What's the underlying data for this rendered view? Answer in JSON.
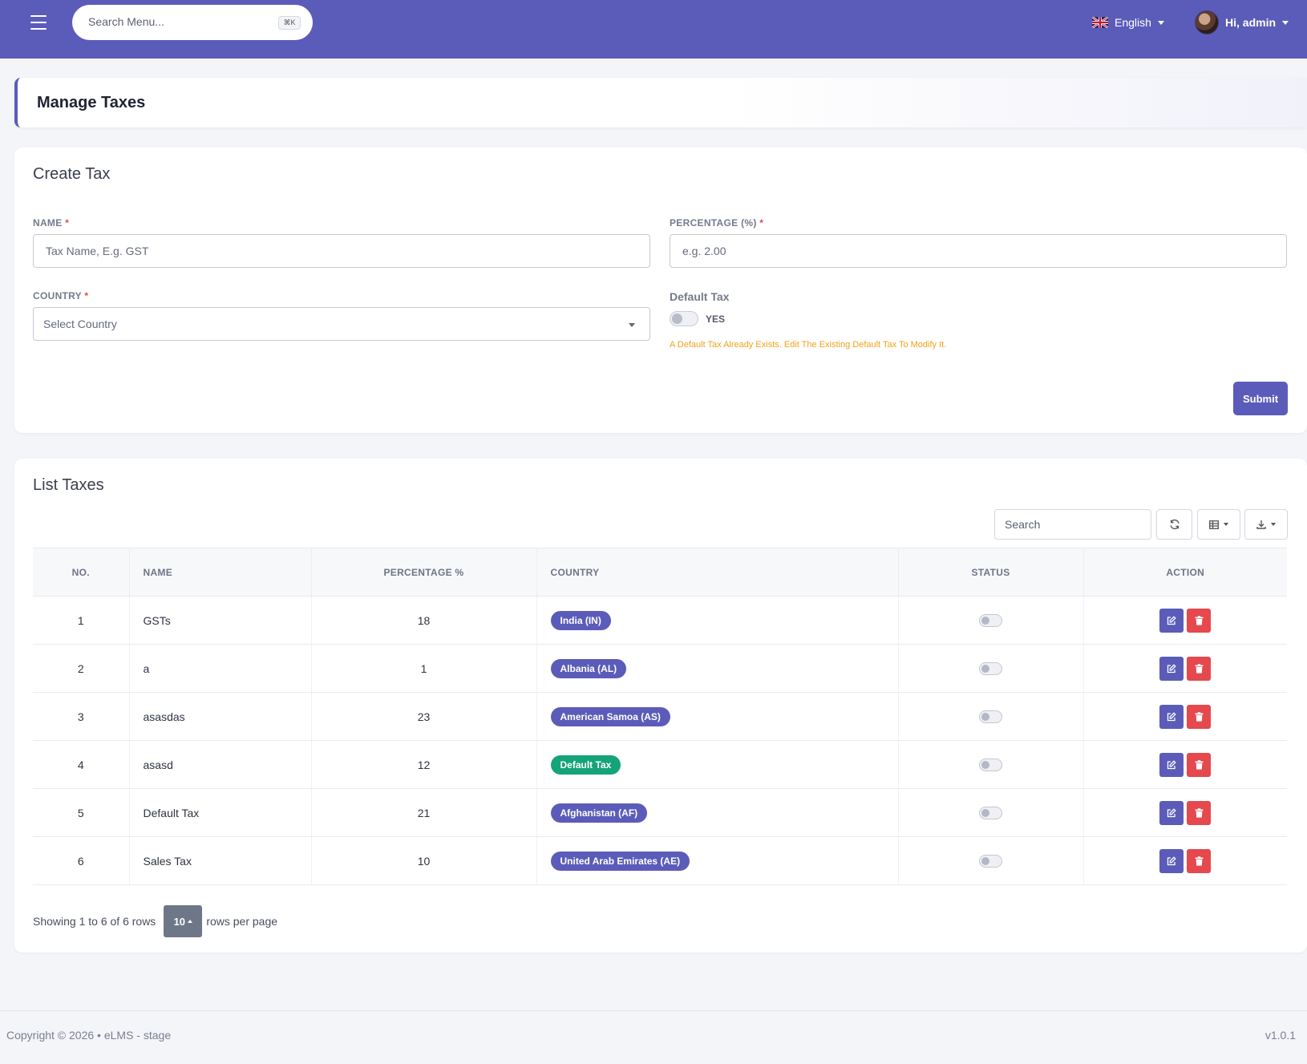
{
  "header": {
    "search_placeholder": "Search Menu...",
    "search_shortcut": "⌘K",
    "language": "English",
    "user_greeting": "Hi, admin"
  },
  "page": {
    "title": "Manage Taxes"
  },
  "create": {
    "title": "Create Tax",
    "name_label": "NAME",
    "name_placeholder": "Tax Name, E.g. GST",
    "percentage_label": "PERCENTAGE (%)",
    "percentage_placeholder": "e.g. 2.00",
    "country_label": "COUNTRY",
    "country_placeholder": "Select Country",
    "required_mark": "*",
    "default_label": "Default Tax",
    "default_toggle_text": "YES",
    "default_warning": "A Default Tax Already Exists. Edit The Existing Default Tax To Modify It.",
    "submit_label": "Submit"
  },
  "list": {
    "title": "List Taxes",
    "search_placeholder": "Search",
    "columns": [
      "NO.",
      "NAME",
      "PERCENTAGE %",
      "COUNTRY",
      "STATUS",
      "ACTION"
    ],
    "rows": [
      {
        "no": "1",
        "name": "GSTs",
        "percentage": "18",
        "country": "India (IN)",
        "badge_color": "#5b5cb9"
      },
      {
        "no": "2",
        "name": "a",
        "percentage": "1",
        "country": "Albania (AL)",
        "badge_color": "#5b5cb9"
      },
      {
        "no": "3",
        "name": "asasdas",
        "percentage": "23",
        "country": "American Samoa (AS)",
        "badge_color": "#5b5cb9"
      },
      {
        "no": "4",
        "name": "asasd",
        "percentage": "12",
        "country": "Default Tax",
        "badge_color": "#15a37a"
      },
      {
        "no": "5",
        "name": "Default Tax",
        "percentage": "21",
        "country": "Afghanistan (AF)",
        "badge_color": "#5b5cb9"
      },
      {
        "no": "6",
        "name": "Sales Tax",
        "percentage": "10",
        "country": "United Arab Emirates (AE)",
        "badge_color": "#5b5cb9"
      }
    ],
    "pagination_text": "Showing 1 to 6 of 6 rows",
    "page_size": "10",
    "rows_per_page_text": "rows per page"
  },
  "footer": {
    "copyright": "Copyright © 2026  •  eLMS - stage",
    "version": "v1.0.1"
  },
  "colors": {
    "primary": "#5b5cb9",
    "danger": "#e5484d",
    "success": "#15a37a",
    "warning": "#f0a21a"
  }
}
